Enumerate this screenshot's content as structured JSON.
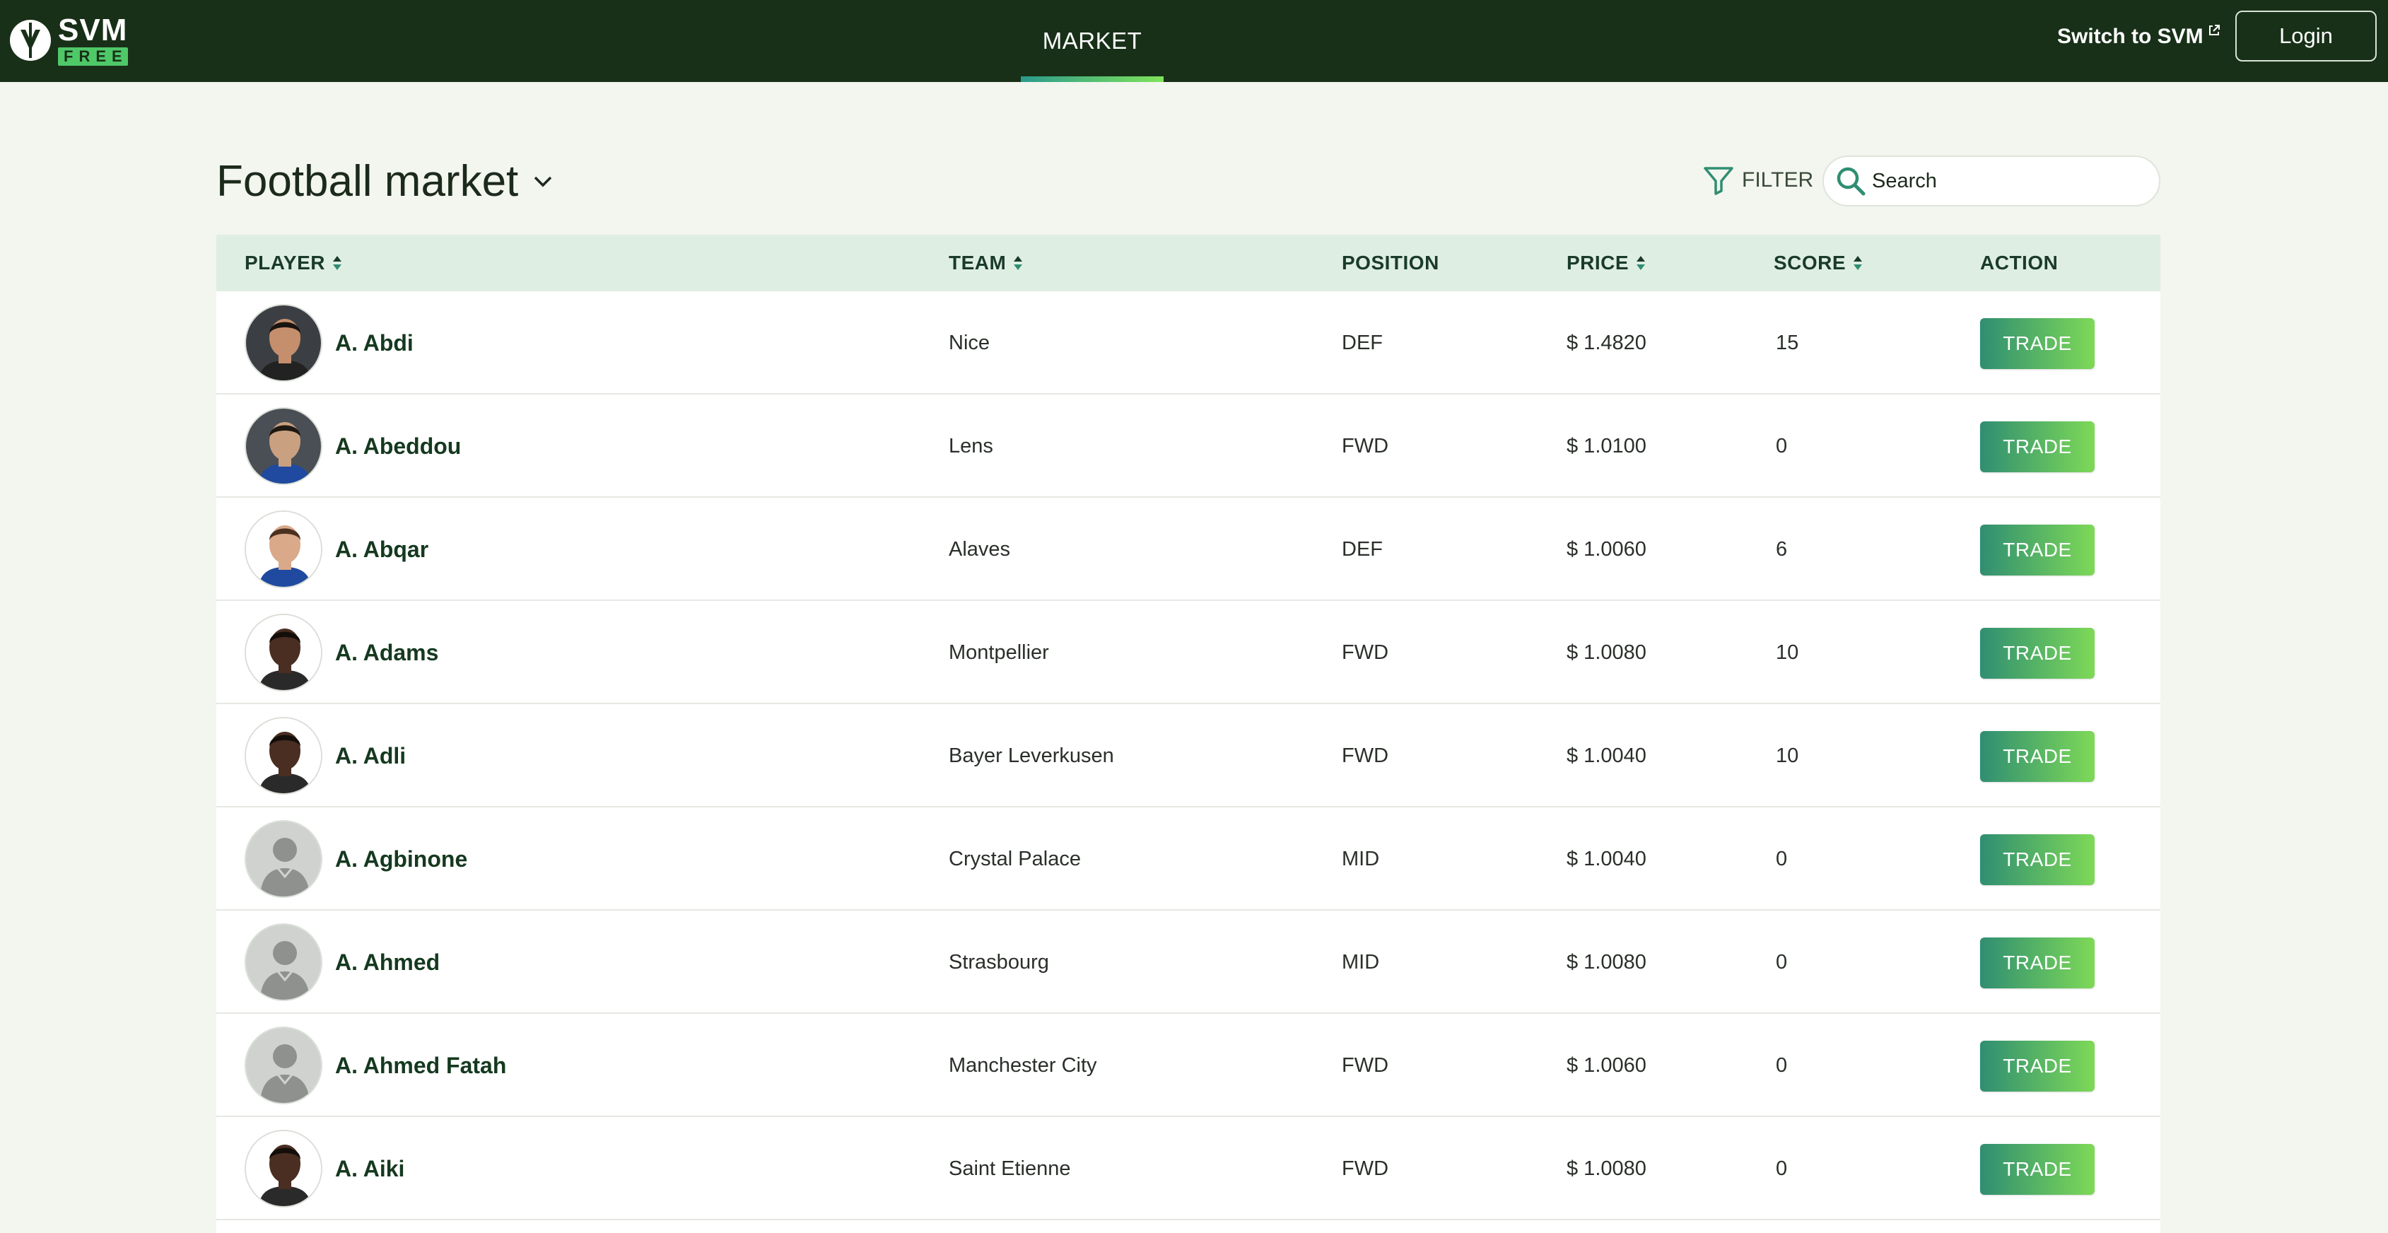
{
  "header": {
    "logo_text": "SVM",
    "logo_badge": "FREE",
    "nav_tab": "MARKET",
    "switch_link": "Switch to SVM",
    "login_label": "Login"
  },
  "page": {
    "title": "Football market",
    "filter_label": "FILTER",
    "search_placeholder": "Search"
  },
  "table": {
    "columns": {
      "player": "PLAYER",
      "team": "TEAM",
      "position": "POSITION",
      "price": "PRICE",
      "score": "SCORE",
      "action": "ACTION"
    },
    "trade_label": "TRADE",
    "rows": [
      {
        "name": "A. Abdi",
        "team": "Nice",
        "position": "DEF",
        "price": "$ 1.4820",
        "score": "15",
        "avatar": "photo-dark-beard"
      },
      {
        "name": "A. Abeddou",
        "team": "Lens",
        "position": "FWD",
        "price": "$ 1.0100",
        "score": "0",
        "avatar": "photo-dark-bg"
      },
      {
        "name": "A. Abqar",
        "team": "Alaves",
        "position": "DEF",
        "price": "$ 1.0060",
        "score": "6",
        "avatar": "photo-light"
      },
      {
        "name": "A. Adams",
        "team": "Montpellier",
        "position": "FWD",
        "price": "$ 1.0080",
        "score": "10",
        "avatar": "photo-dark-skin"
      },
      {
        "name": "A. Adli",
        "team": "Bayer Leverkusen",
        "position": "FWD",
        "price": "$ 1.0040",
        "score": "10",
        "avatar": "photo-dark-skin"
      },
      {
        "name": "A. Agbinone",
        "team": "Crystal Palace",
        "position": "MID",
        "price": "$ 1.0040",
        "score": "0",
        "avatar": "placeholder-silhouette"
      },
      {
        "name": "A. Ahmed",
        "team": "Strasbourg",
        "position": "MID",
        "price": "$ 1.0080",
        "score": "0",
        "avatar": "placeholder-silhouette"
      },
      {
        "name": "A. Ahmed Fatah",
        "team": "Manchester City",
        "position": "FWD",
        "price": "$ 1.0060",
        "score": "0",
        "avatar": "placeholder-silhouette"
      },
      {
        "name": "A. Aiki",
        "team": "Saint Etienne",
        "position": "FWD",
        "price": "$ 1.0080",
        "score": "0",
        "avatar": "photo-dark-skin"
      }
    ]
  },
  "colors": {
    "header_bg": "#183018",
    "accent_gradient_start": "#2f8e72",
    "accent_gradient_end": "#7ed957",
    "table_header_bg": "#dfeee3",
    "page_bg": "#f3f5ef"
  }
}
